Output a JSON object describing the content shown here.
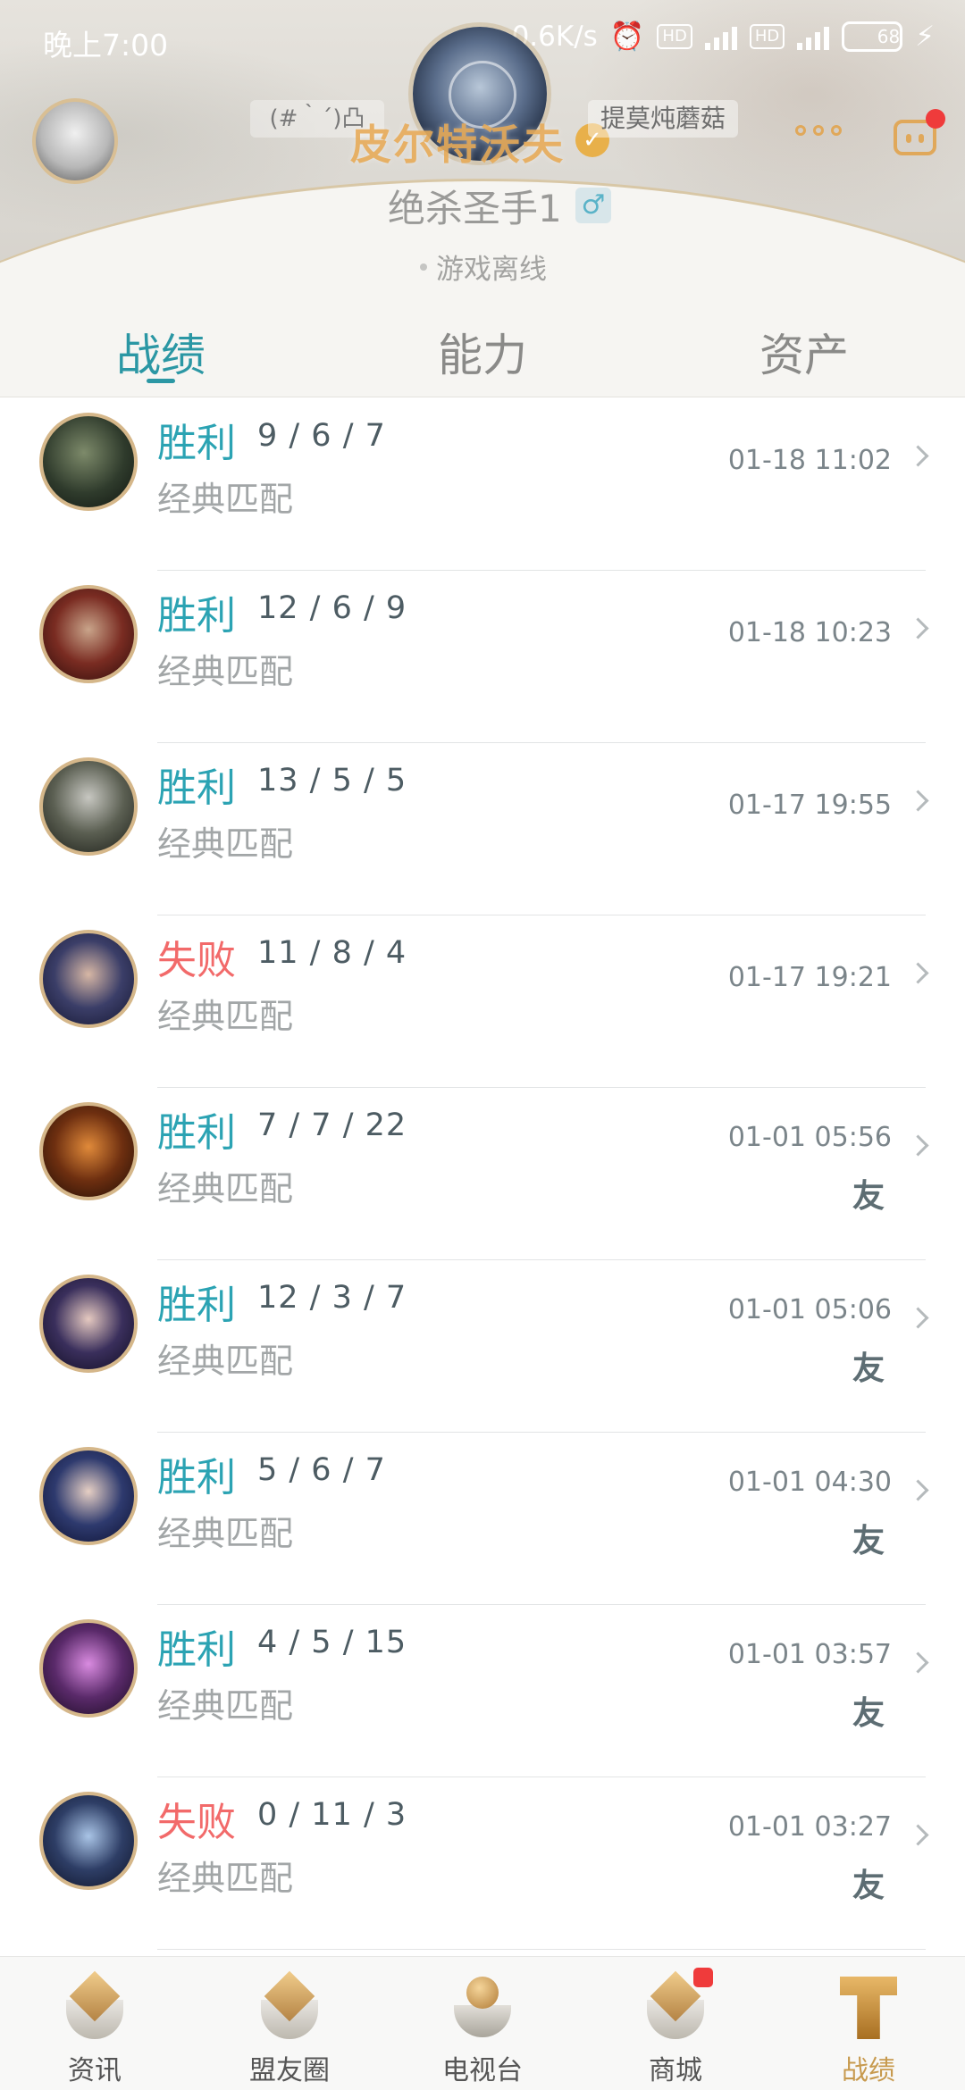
{
  "status_bar": {
    "time": "晚上7:00",
    "network_speed": "0.6K/s",
    "battery": "68",
    "battery_level": 0.68,
    "hd_label": "HD"
  },
  "profile": {
    "emote": "(#｀´)凸",
    "region": "皮尔特沃夫",
    "nickname_tag": "提莫炖蘑菇",
    "player_name": "绝杀圣手1",
    "gender_symbol": "♂",
    "online_status": "游戏离线"
  },
  "tabs": [
    {
      "label": "战绩",
      "active": true
    },
    {
      "label": "能力",
      "active": false
    },
    {
      "label": "资产",
      "active": false
    }
  ],
  "matches": [
    {
      "result": "胜利",
      "outcome": "win",
      "kda": "9 / 6 / 7",
      "mode": "经典匹配",
      "time": "01-18 11:02",
      "friend": ""
    },
    {
      "result": "胜利",
      "outcome": "win",
      "kda": "12 / 6 / 9",
      "mode": "经典匹配",
      "time": "01-18 10:23",
      "friend": ""
    },
    {
      "result": "胜利",
      "outcome": "win",
      "kda": "13 / 5 / 5",
      "mode": "经典匹配",
      "time": "01-17 19:55",
      "friend": ""
    },
    {
      "result": "失败",
      "outcome": "loss",
      "kda": "11 / 8 / 4",
      "mode": "经典匹配",
      "time": "01-17 19:21",
      "friend": ""
    },
    {
      "result": "胜利",
      "outcome": "win",
      "kda": "7 / 7 / 22",
      "mode": "经典匹配",
      "time": "01-01 05:56",
      "friend": "友"
    },
    {
      "result": "胜利",
      "outcome": "win",
      "kda": "12 / 3 / 7",
      "mode": "经典匹配",
      "time": "01-01 05:06",
      "friend": "友"
    },
    {
      "result": "胜利",
      "outcome": "win",
      "kda": "5 / 6 / 7",
      "mode": "经典匹配",
      "time": "01-01 04:30",
      "friend": "友"
    },
    {
      "result": "胜利",
      "outcome": "win",
      "kda": "4 / 5 / 15",
      "mode": "经典匹配",
      "time": "01-01 03:57",
      "friend": "友"
    },
    {
      "result": "失败",
      "outcome": "loss",
      "kda": "0 / 11 / 3",
      "mode": "经典匹配",
      "time": "01-01 03:27",
      "friend": "友"
    }
  ],
  "bottom_nav": [
    {
      "label": "资讯",
      "icon": "news-icon",
      "active": false
    },
    {
      "label": "盟友圈",
      "icon": "friends-circle-icon",
      "active": false
    },
    {
      "label": "电视台",
      "icon": "tv-icon",
      "active": false
    },
    {
      "label": "商城",
      "icon": "store-icon",
      "active": false,
      "badge": true
    },
    {
      "label": "战绩",
      "icon": "trophy-icon",
      "active": true
    }
  ],
  "colors": {
    "win": "#2ba3b3",
    "loss": "#f26a6a",
    "accent": "#2b97a4",
    "gold": "#c79a4e"
  }
}
